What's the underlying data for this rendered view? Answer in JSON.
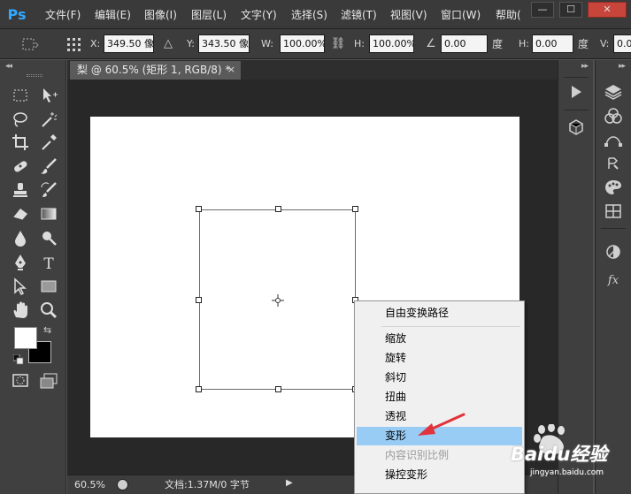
{
  "app": {
    "logo": "Ps"
  },
  "menubar": {
    "items": [
      "文件(F)",
      "编辑(E)",
      "图像(I)",
      "图层(L)",
      "文字(Y)",
      "选择(S)",
      "滤镜(T)",
      "视图(V)",
      "窗口(W)",
      "帮助("
    ],
    "window_buttons": [
      "—",
      "☐",
      "✕"
    ]
  },
  "options": {
    "x_label": "X:",
    "x_value": "349.50 像",
    "y_label": "Y:",
    "y_value": "343.50 像",
    "w_label": "W:",
    "w_value": "100.00%",
    "h_label": "H:",
    "h_value": "100.00%",
    "angle_value": "0.00",
    "angle_unit": "度",
    "hskew_label": "H:",
    "hskew_value": "0.00",
    "hskew_unit": "度",
    "v_label": "V:",
    "v_value": "0.0"
  },
  "document": {
    "tab_title": "梨 @ 60.5% (矩形 1, RGB/8) *",
    "tab_close": "×"
  },
  "status": {
    "zoom": "60.5%",
    "doc_info": "文档:1.37M/0 字节"
  },
  "context_menu": {
    "items": [
      {
        "label": "自由变换路径",
        "state": "normal"
      },
      {
        "label": "缩放",
        "state": "normal"
      },
      {
        "label": "旋转",
        "state": "normal"
      },
      {
        "label": "斜切",
        "state": "normal"
      },
      {
        "label": "扭曲",
        "state": "normal"
      },
      {
        "label": "透视",
        "state": "normal"
      },
      {
        "label": "变形",
        "state": "selected"
      },
      {
        "label": "内容识别比例",
        "state": "disabled"
      },
      {
        "label": "操控变形",
        "state": "normal"
      }
    ]
  },
  "watermark": {
    "text": "Baidu经验",
    "subtext": "jingyan.baidu.com"
  },
  "colors": {
    "accent": "#31a8ff",
    "menu_highlight": "#99ccf5",
    "annotation_arrow": "#e0333b",
    "foreground_color": "#ffffff",
    "background_color": "#000000"
  }
}
